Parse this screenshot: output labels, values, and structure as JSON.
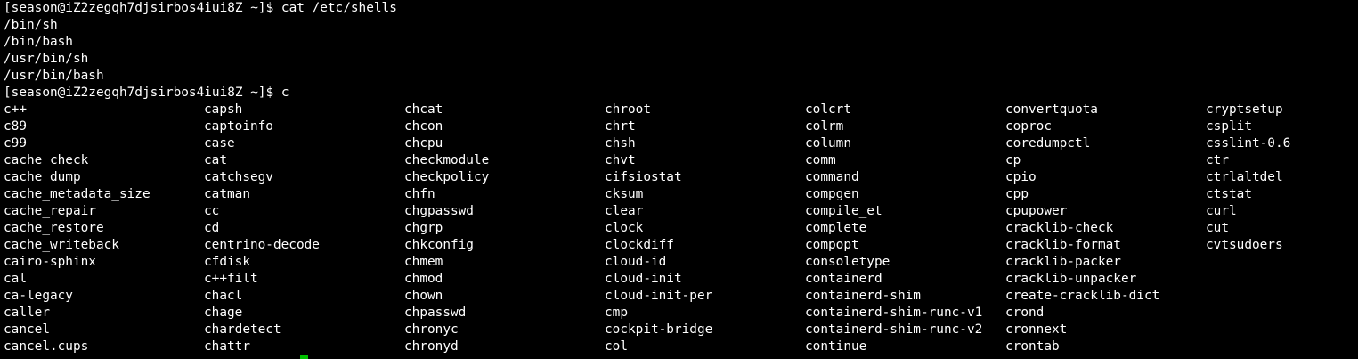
{
  "terminal": {
    "colors": {
      "background": "#000000",
      "foreground": "#ffffff",
      "cursor": "#00c000"
    },
    "lines": [
      "[season@iZ2zegqh7djsirbos4iui8Z ~]$ cat /etc/shells",
      "/bin/sh",
      "/bin/bash",
      "/usr/bin/sh",
      "/usr/bin/bash",
      "[season@iZ2zegqh7djsirbos4iui8Z ~]$ c"
    ],
    "completion_columns": [
      [
        "c++",
        "c89",
        "c99",
        "cache_check",
        "cache_dump",
        "cache_metadata_size",
        "cache_repair",
        "cache_restore",
        "cache_writeback",
        "cairo-sphinx",
        "cal",
        "ca-legacy",
        "caller",
        "cancel",
        "cancel.cups"
      ],
      [
        "capsh",
        "captoinfo",
        "case",
        "cat",
        "catchsegv",
        "catman",
        "cc",
        "cd",
        "centrino-decode",
        "cfdisk",
        "c++filt",
        "chacl",
        "chage",
        "chardetect",
        "chattr"
      ],
      [
        "chcat",
        "chcon",
        "chcpu",
        "checkmodule",
        "checkpolicy",
        "chfn",
        "chgpasswd",
        "chgrp",
        "chkconfig",
        "chmem",
        "chmod",
        "chown",
        "chpasswd",
        "chronyc",
        "chronyd"
      ],
      [
        "chroot",
        "chrt",
        "chsh",
        "chvt",
        "cifsiostat",
        "cksum",
        "clear",
        "clock",
        "clockdiff",
        "cloud-id",
        "cloud-init",
        "cloud-init-per",
        "cmp",
        "cockpit-bridge",
        "col"
      ],
      [
        "colcrt",
        "colrm",
        "column",
        "comm",
        "command",
        "compgen",
        "compile_et",
        "complete",
        "compopt",
        "consoletype",
        "containerd",
        "containerd-shim",
        "containerd-shim-runc-v1",
        "containerd-shim-runc-v2",
        "continue"
      ],
      [
        "convertquota",
        "coproc",
        "coredumpctl",
        "cp",
        "cpio",
        "cpp",
        "cpupower",
        "cracklib-check",
        "cracklib-format",
        "cracklib-packer",
        "cracklib-unpacker",
        "create-cracklib-dict",
        "crond",
        "cronnext",
        "crontab"
      ],
      [
        "cryptsetup",
        "csplit",
        "csslint-0.6",
        "ctr",
        "ctrlaltdel",
        "ctstat",
        "curl",
        "cut",
        "cvtsudoers"
      ]
    ]
  }
}
